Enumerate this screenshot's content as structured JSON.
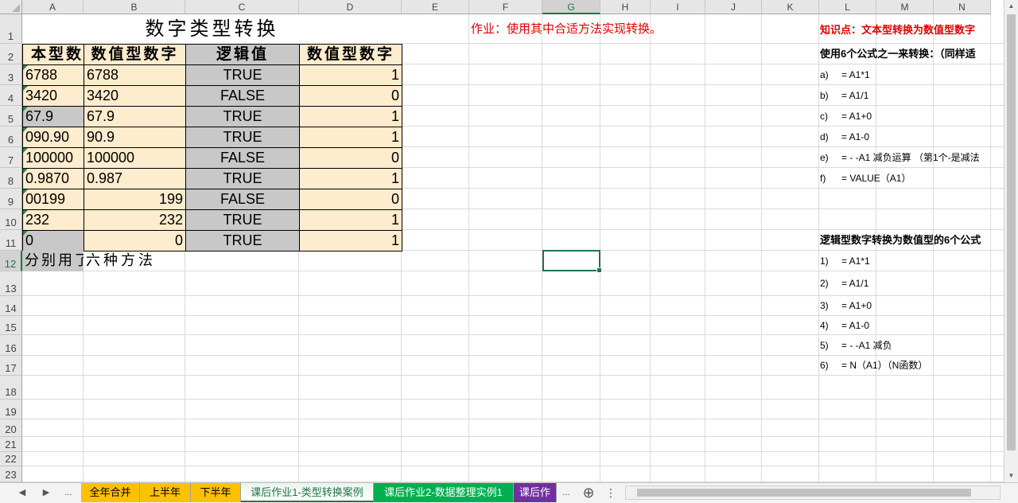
{
  "columns": [
    "A",
    "B",
    "C",
    "D",
    "E",
    "F",
    "G",
    "H",
    "I",
    "J",
    "K",
    "L",
    "M",
    "N"
  ],
  "selected_column": "G",
  "rows": [
    "1",
    "2",
    "3",
    "4",
    "5",
    "6",
    "7",
    "8",
    "9",
    "10",
    "11",
    "12",
    "13",
    "14",
    "15",
    "16",
    "17",
    "18",
    "19",
    "20",
    "21",
    "22",
    "23"
  ],
  "selected_row": "12",
  "sheet_title": "数字类型转换",
  "table_headers": [
    "本型数",
    "数值型数字",
    "逻辑值",
    "数值型数字"
  ],
  "table_rows": [
    {
      "text": "6788",
      "num": "6788",
      "logic": "TRUE",
      "n": "1"
    },
    {
      "text": "3420",
      "num": "3420",
      "logic": "FALSE",
      "n": "0"
    },
    {
      "text": "67.9",
      "num": "67.9",
      "logic": "TRUE",
      "n": "1"
    },
    {
      "text": "090.90",
      "num": "90.9",
      "logic": "TRUE",
      "n": "1"
    },
    {
      "text": "100000",
      "num": "100000",
      "logic": "FALSE",
      "n": "0"
    },
    {
      "text": "0.9870",
      "num": "0.987",
      "logic": "TRUE",
      "n": "1"
    },
    {
      "text": "00199",
      "num": "199",
      "logic": "FALSE",
      "n": "0"
    },
    {
      "text": "232",
      "num": "232",
      "logic": "TRUE",
      "n": "1"
    },
    {
      "text": "0",
      "num": "0",
      "logic": "TRUE",
      "n": "1"
    }
  ],
  "footer_a": "分别用了",
  "footer_b": "六种方法",
  "homework": "作业：使用其中合适方法实现转换。",
  "knowledge_title": "知识点：文本型转换为数值型数字",
  "text_methods_intro": "使用6个公式之一来转换：（同样适",
  "text_methods": [
    {
      "key": "a)",
      "formula": "= A1*1"
    },
    {
      "key": "b)",
      "formula": "= A1/1"
    },
    {
      "key": "c)",
      "formula": "= A1+0"
    },
    {
      "key": "d)",
      "formula": "= A1-0"
    },
    {
      "key": "e)",
      "formula": "= - -A1 减负运算 （第1个-是减法"
    },
    {
      "key": "f)",
      "formula": "= VALUE（A1）"
    }
  ],
  "logic_title": "逻辑型数字转换为数值型的6个公式",
  "logic_methods": [
    {
      "key": "1)",
      "formula": "= A1*1"
    },
    {
      "key": "2)",
      "formula": "= A1/1"
    },
    {
      "key": "3)",
      "formula": "= A1+0"
    },
    {
      "key": "4)",
      "formula": "= A1-0"
    },
    {
      "key": "5)",
      "formula": "= - -A1 减负"
    },
    {
      "key": "6)",
      "formula": "= N（A1）（N函数）"
    }
  ],
  "tabs": [
    {
      "label": "全年合并",
      "color": "#ffc000"
    },
    {
      "label": "上半年",
      "color": "#ffc000"
    },
    {
      "label": "下半年",
      "color": "#ffc000"
    },
    {
      "label": "课后作业1-类型转换案例",
      "color": "#ffffff",
      "active": true
    },
    {
      "label": "课后作业2-数据整理实例1",
      "color": "#00b050"
    },
    {
      "label": "课后作",
      "color": "#7030a0"
    }
  ],
  "tab_overflow_left": "...",
  "tab_overflow_right": "...",
  "colors": {
    "accent": "#217346",
    "red_text": "#e00000",
    "table_beige": "#fdeccd",
    "table_gray": "#c8c8c8"
  }
}
